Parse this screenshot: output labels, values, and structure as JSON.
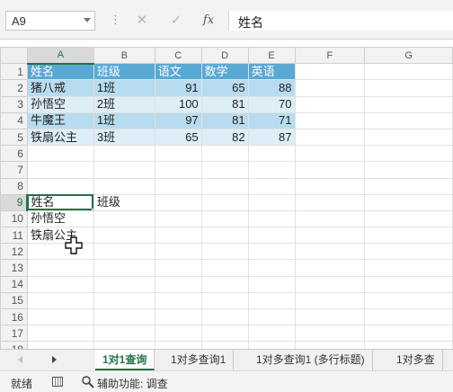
{
  "formula_bar": {
    "name_box": "A9",
    "cancel_icon": "✕",
    "enter_icon": "✓",
    "fx_label": "fx",
    "formula": "姓名"
  },
  "columns": [
    "A",
    "B",
    "C",
    "D",
    "E",
    "F",
    "G"
  ],
  "selected_column": "A",
  "selected_row": "9",
  "rows": [
    {
      "n": "1",
      "cells": [
        "姓名",
        "班级",
        "语文",
        "数学",
        "英语",
        "",
        ""
      ],
      "style": "hdr"
    },
    {
      "n": "2",
      "cells": [
        "猪八戒",
        "1班",
        "91",
        "65",
        "88",
        "",
        ""
      ],
      "style": "band1"
    },
    {
      "n": "3",
      "cells": [
        "孙悟空",
        "2班",
        "100",
        "81",
        "70",
        "",
        ""
      ],
      "style": "band2"
    },
    {
      "n": "4",
      "cells": [
        "牛魔王",
        "1班",
        "97",
        "81",
        "71",
        "",
        ""
      ],
      "style": "band1"
    },
    {
      "n": "5",
      "cells": [
        "铁扇公主",
        "3班",
        "65",
        "82",
        "87",
        "",
        ""
      ],
      "style": "band2"
    },
    {
      "n": "6",
      "cells": [
        "",
        "",
        "",
        "",
        "",
        "",
        ""
      ]
    },
    {
      "n": "7",
      "cells": [
        "",
        "",
        "",
        "",
        "",
        "",
        ""
      ]
    },
    {
      "n": "8",
      "cells": [
        "",
        "",
        "",
        "",
        "",
        "",
        ""
      ]
    },
    {
      "n": "9",
      "cells": [
        "姓名",
        "班级",
        "",
        "",
        "",
        "",
        ""
      ]
    },
    {
      "n": "10",
      "cells": [
        "孙悟空",
        "",
        "",
        "",
        "",
        "",
        ""
      ]
    },
    {
      "n": "11",
      "cells": [
        "铁扇公主",
        "",
        "",
        "",
        "",
        "",
        ""
      ]
    },
    {
      "n": "12",
      "cells": [
        "",
        "",
        "",
        "",
        "",
        "",
        ""
      ]
    },
    {
      "n": "13",
      "cells": [
        "",
        "",
        "",
        "",
        "",
        "",
        ""
      ]
    },
    {
      "n": "14",
      "cells": [
        "",
        "",
        "",
        "",
        "",
        "",
        ""
      ]
    },
    {
      "n": "15",
      "cells": [
        "",
        "",
        "",
        "",
        "",
        "",
        ""
      ]
    },
    {
      "n": "16",
      "cells": [
        "",
        "",
        "",
        "",
        "",
        "",
        ""
      ]
    },
    {
      "n": "17",
      "cells": [
        "",
        "",
        "",
        "",
        "",
        "",
        ""
      ]
    },
    {
      "n": "18",
      "cells": [
        "",
        "",
        "",
        "",
        "",
        "",
        ""
      ]
    }
  ],
  "sheet_tabs": [
    "1对1查询",
    "1对多查询1",
    "1对多查询1 (多行标题)",
    "1对多查"
  ],
  "active_tab": 0,
  "status_bar": {
    "ready": "就绪",
    "accessibility": "辅助功能: 调查"
  },
  "colors": {
    "accent": "#217346",
    "table_header": "#5aa8d4",
    "band_dark": "#b8dcef",
    "band_light": "#dceef8"
  }
}
